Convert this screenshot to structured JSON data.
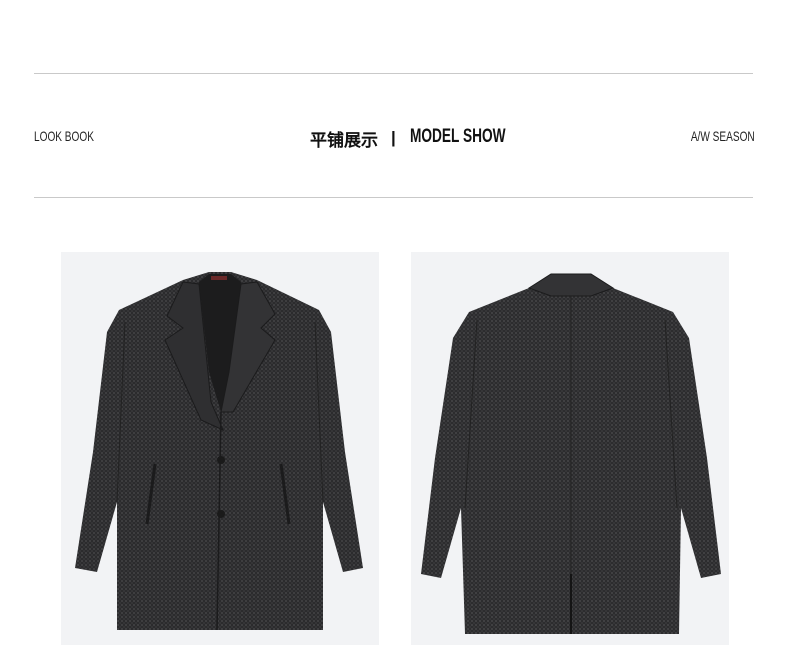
{
  "header": {
    "left_label": "LOOK BOOK",
    "title_cn": "平铺展示",
    "separator": "|",
    "title_en": "MODEL SHOW",
    "right_label": "A/W SEASON"
  },
  "colors": {
    "background": "#ffffff",
    "rule": "#c9c9c9",
    "photo_bg": "#f2f3f5",
    "fabric_dark": "#2d2d2f",
    "fabric_light": "#4a4a4c"
  },
  "images": [
    {
      "name": "coat-front-photo",
      "icon": "coat-front"
    },
    {
      "name": "coat-back-photo",
      "icon": "coat-back"
    }
  ]
}
